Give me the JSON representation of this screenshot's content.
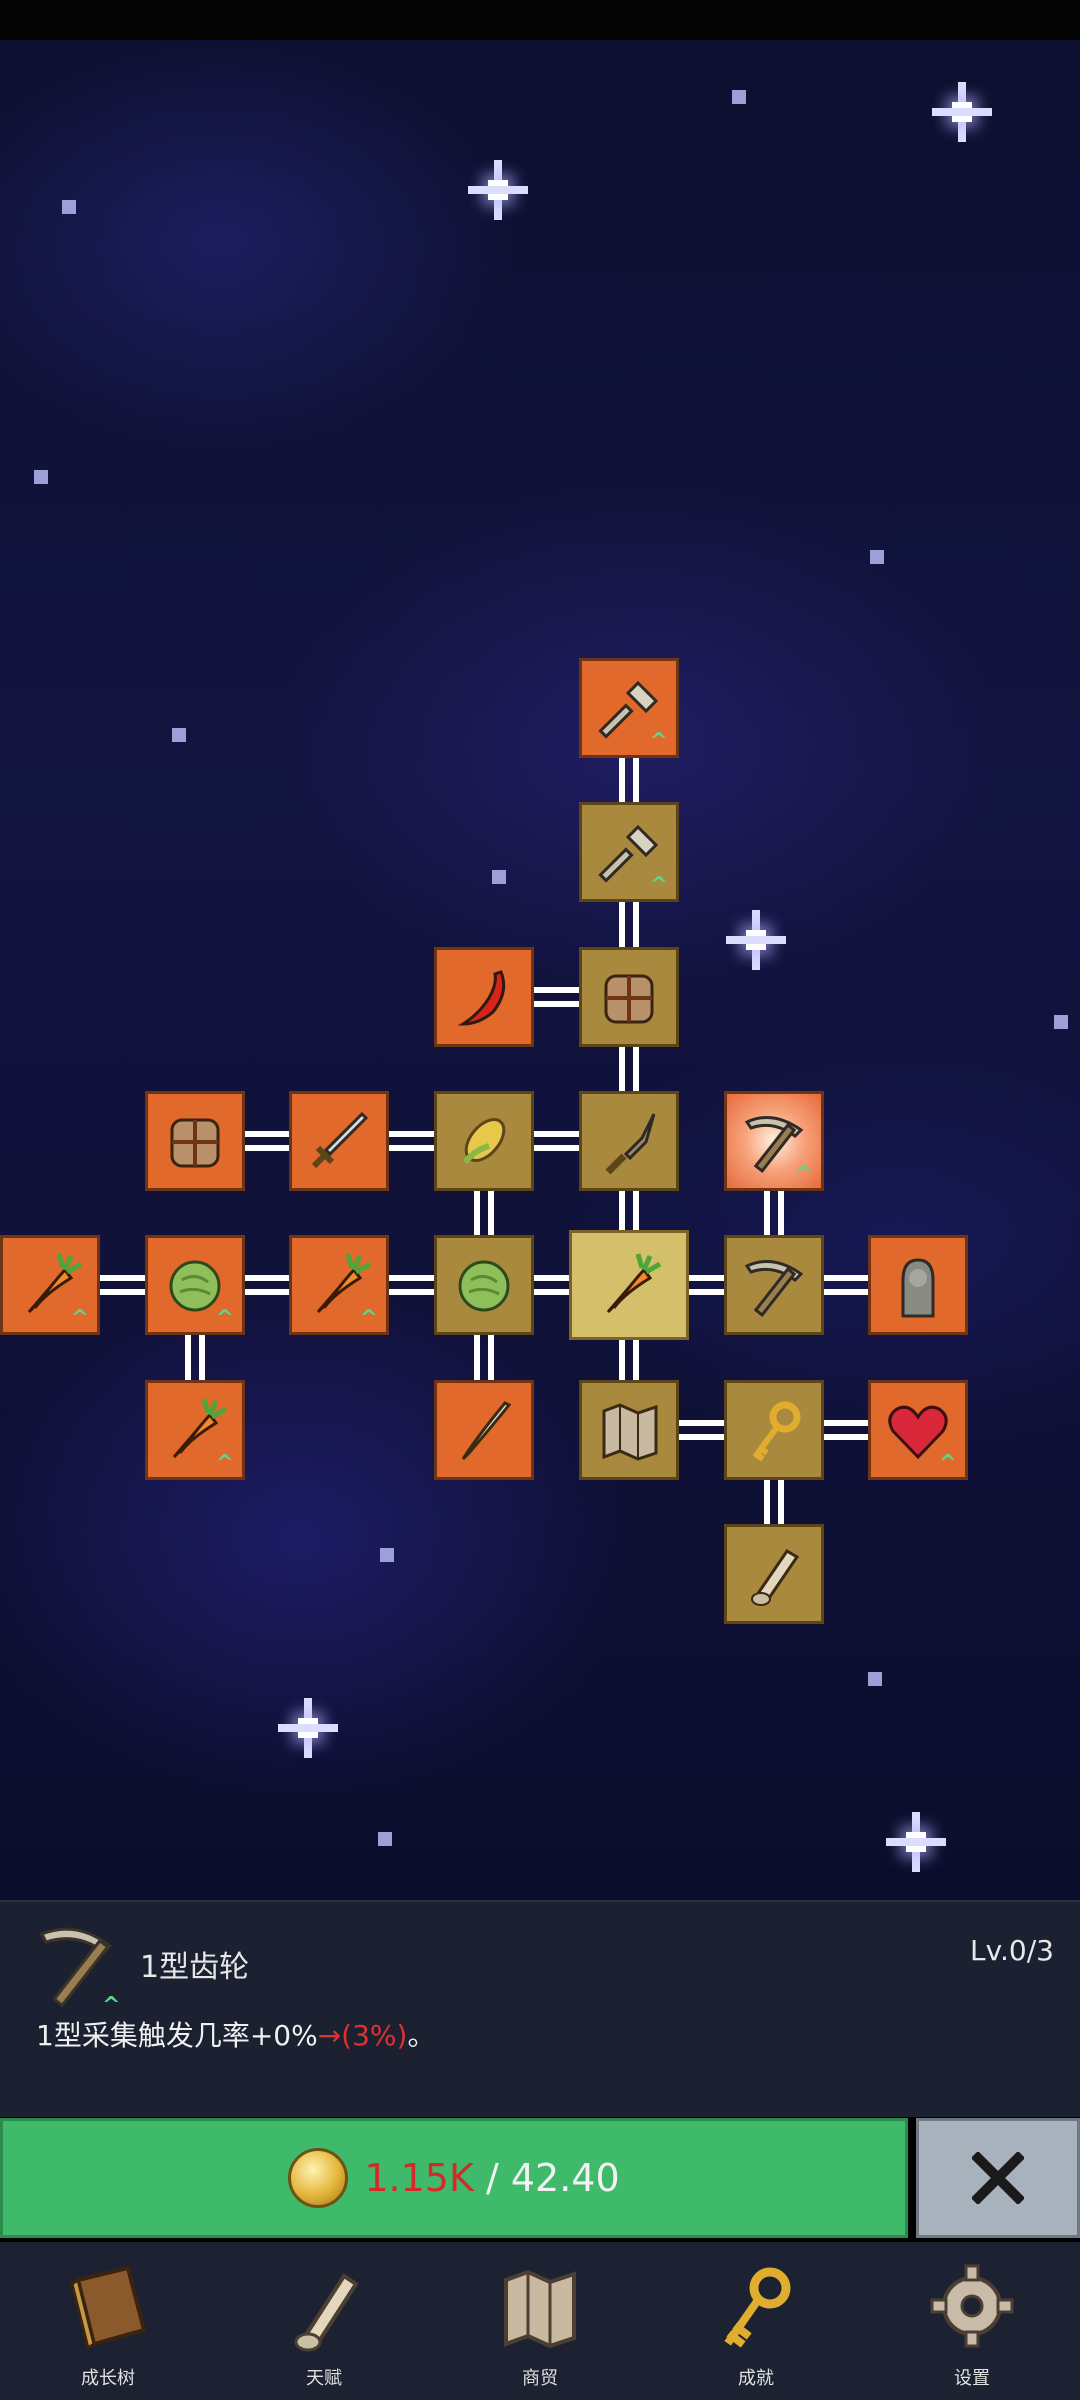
{
  "skill": {
    "name": "1型齿轮",
    "level": "Lv.0/3",
    "desc_prefix": "1型采集触发几率+0%",
    "desc_highlight": "→(3%)",
    "desc_suffix": "。",
    "icon": "pickaxe-icon"
  },
  "purchase": {
    "cost": "1.15K",
    "separator": " / ",
    "balance": "42.40",
    "currency_icon": "coin-icon"
  },
  "close_icon": "close-icon",
  "nav": {
    "items": [
      {
        "label": "成长树",
        "icon": "book-icon"
      },
      {
        "label": "天赋",
        "icon": "scroll-icon"
      },
      {
        "label": "商贸",
        "icon": "map-icon"
      },
      {
        "label": "成就",
        "icon": "key-icon"
      },
      {
        "label": "设置",
        "icon": "gear-icon"
      }
    ]
  },
  "tree_nodes": [
    {
      "icon": "shovel-icon",
      "state": "orange",
      "upgrade": true
    },
    {
      "icon": "shovel-icon",
      "state": "gold",
      "upgrade": true
    },
    {
      "icon": "chili-icon",
      "state": "orange",
      "upgrade": false
    },
    {
      "icon": "backpack-icon",
      "state": "gold",
      "upgrade": false
    },
    {
      "icon": "backpack-icon",
      "state": "orange",
      "upgrade": false
    },
    {
      "icon": "sword-icon",
      "state": "orange",
      "upgrade": false
    },
    {
      "icon": "corn-icon",
      "state": "gold",
      "upgrade": false
    },
    {
      "icon": "dagger-icon",
      "state": "gold",
      "upgrade": false
    },
    {
      "icon": "pickaxe-icon",
      "state": "selected",
      "upgrade": true
    },
    {
      "icon": "carrot-icon",
      "state": "orange",
      "upgrade": true
    },
    {
      "icon": "cabbage-icon",
      "state": "orange",
      "upgrade": true
    },
    {
      "icon": "carrot-icon",
      "state": "orange",
      "upgrade": true
    },
    {
      "icon": "cabbage-icon",
      "state": "gold",
      "upgrade": false
    },
    {
      "icon": "carrot-icon",
      "state": "center",
      "upgrade": false
    },
    {
      "icon": "pickaxe-icon",
      "state": "gold",
      "upgrade": false
    },
    {
      "icon": "statue-icon",
      "state": "orange",
      "upgrade": false
    },
    {
      "icon": "carrot-icon",
      "state": "orange",
      "upgrade": true
    },
    {
      "icon": "root-icon",
      "state": "orange",
      "upgrade": false
    },
    {
      "icon": "map-icon",
      "state": "gold",
      "upgrade": false
    },
    {
      "icon": "key-icon",
      "state": "gold",
      "upgrade": false
    },
    {
      "icon": "heart-icon",
      "state": "orange",
      "upgrade": true
    },
    {
      "icon": "scroll-icon",
      "state": "gold",
      "upgrade": false
    }
  ]
}
